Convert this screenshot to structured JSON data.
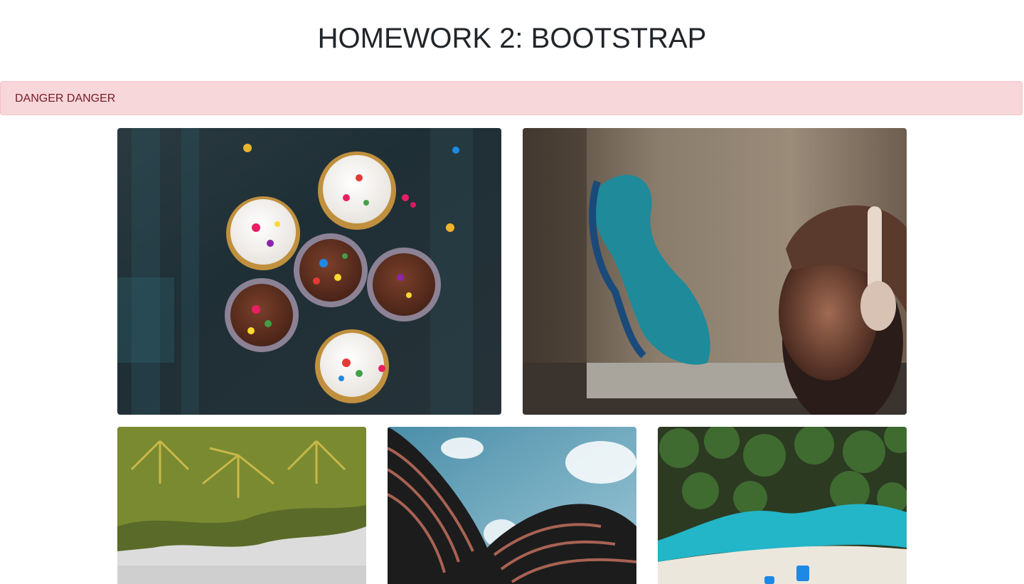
{
  "header": {
    "title": "HOMEWORK 2: BOOTSTRAP"
  },
  "alert": {
    "text": "DANGER DANGER",
    "background_color": "#f8d7da",
    "text_color": "#721c24"
  },
  "gallery": {
    "row1": [
      "cupcakes-photo",
      "graffiti-photo"
    ],
    "row2": [
      "palm-trees-photo",
      "building-photo",
      "beach-photo"
    ]
  }
}
